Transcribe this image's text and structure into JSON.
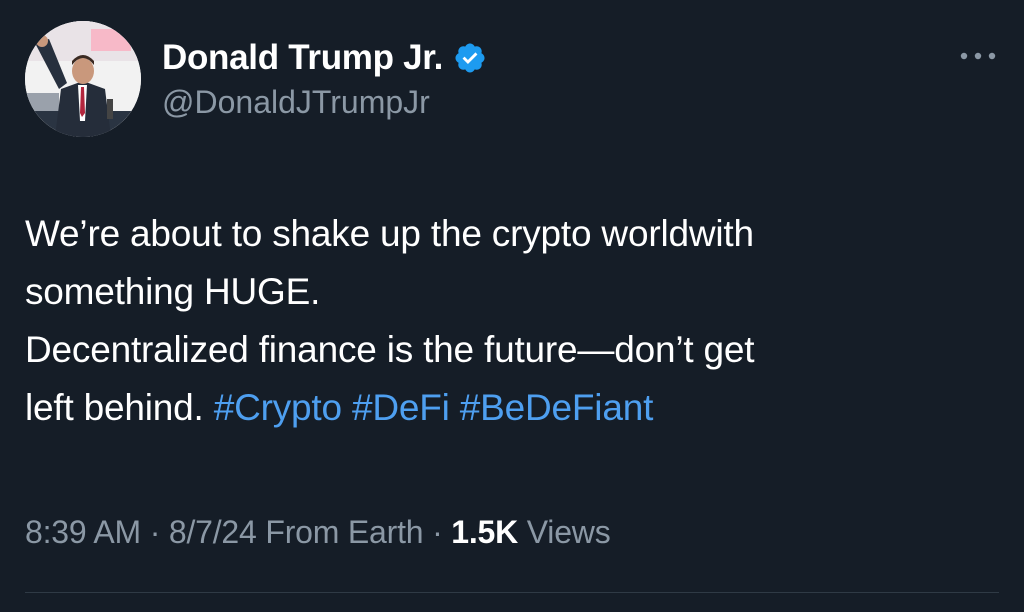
{
  "author": {
    "display_name": "Donald Trump Jr.",
    "handle": "@DonaldJTrumpJr",
    "verified": true,
    "verified_badge_icon": "verified-badge-icon",
    "verified_color": "#1d9bf0"
  },
  "tweet": {
    "line1": "We’re about to shake up the crypto worldwith",
    "line2": "something HUGE.",
    "line3": "Decentralized finance is the future—don’t get",
    "line4_text": "left behind. ",
    "hashtags": [
      "#Crypto",
      "#DeFi",
      "#BeDeFiant"
    ],
    "hashtag_color": "#4e9ff0"
  },
  "meta": {
    "time": "8:39 AM",
    "separator": " · ",
    "date": "8/7/24",
    "source": "From Earth",
    "views_count": "1.5K",
    "views_label": "Views"
  },
  "menu": {
    "more_icon": "more-horizontal-icon"
  }
}
